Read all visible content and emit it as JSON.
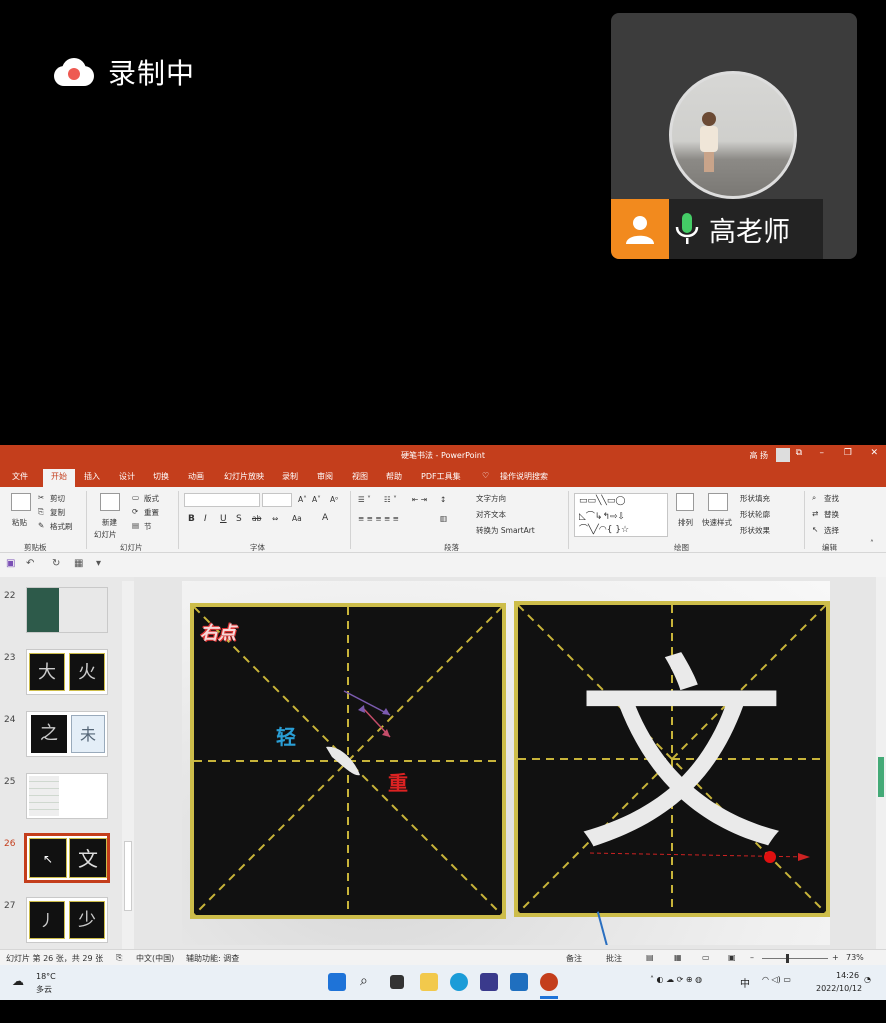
{
  "recording": {
    "label": "录制中",
    "dot_color": "#ee5a52"
  },
  "participant": {
    "name": "高老师",
    "accent": "#f28a1e",
    "mic_color": "#44cc66"
  },
  "window": {
    "title": "硬笔书法  -  PowerPoint",
    "user": "高 扬",
    "brand_color": "#c43e1c"
  },
  "tabs": [
    "文件",
    "开始",
    "插入",
    "设计",
    "切换",
    "动画",
    "幻灯片放映",
    "录制",
    "审阅",
    "视图",
    "帮助",
    "PDF工具集",
    "操作说明搜索"
  ],
  "ribbon": {
    "clipboard": {
      "paste": "粘贴",
      "cut": "剪切",
      "copy": "复制",
      "format_painter": "格式刷",
      "group": "剪贴板"
    },
    "slides": {
      "new_slide": "新建",
      "new_slide2": "幻灯片",
      "layout": "版式",
      "reset": "重置",
      "section": "节",
      "group": "幻灯片"
    },
    "font": {
      "group": "字体",
      "bold": "B",
      "italic": "I",
      "underline": "U",
      "strike": "S",
      "spacing": "ab",
      "case": "Aa",
      "fontA": "A"
    },
    "paragraph": {
      "text_direction": "文字方向",
      "align_text": "对齐文本",
      "smartart": "转换为 SmartArt",
      "group": "段落"
    },
    "drawing": {
      "arrange": "排列",
      "quick_styles": "快速样式",
      "fill": "形状填充",
      "outline": "形状轮廓",
      "effects": "形状效果",
      "group": "绘图"
    },
    "editing": {
      "find": "查找",
      "replace": "替换",
      "select": "选择",
      "group": "编辑"
    }
  },
  "thumbnails": [
    {
      "num": "22",
      "selected": false
    },
    {
      "num": "23",
      "selected": false
    },
    {
      "num": "24",
      "selected": false
    },
    {
      "num": "25",
      "selected": false
    },
    {
      "num": "26",
      "selected": true
    },
    {
      "num": "27",
      "selected": false
    }
  ],
  "slide": {
    "title_tag": "右点",
    "light_label": "轻",
    "heavy_label": "重",
    "character": "文",
    "light_color": "#2a9fd6",
    "heavy_color": "#dd2222",
    "board_border": "#cdbd4a",
    "guide_color": "#c8b43a"
  },
  "status": {
    "slide_info": "幻灯片 第 26 张，共 29 张",
    "language": "中文(中国)",
    "accessibility": "辅助功能: 调查",
    "notes": "备注",
    "comments": "批注",
    "zoom": "73%"
  },
  "taskbar": {
    "temp": "18°C",
    "weather": "多云",
    "ime": "中",
    "time": "14:26",
    "date": "2022/10/12"
  }
}
